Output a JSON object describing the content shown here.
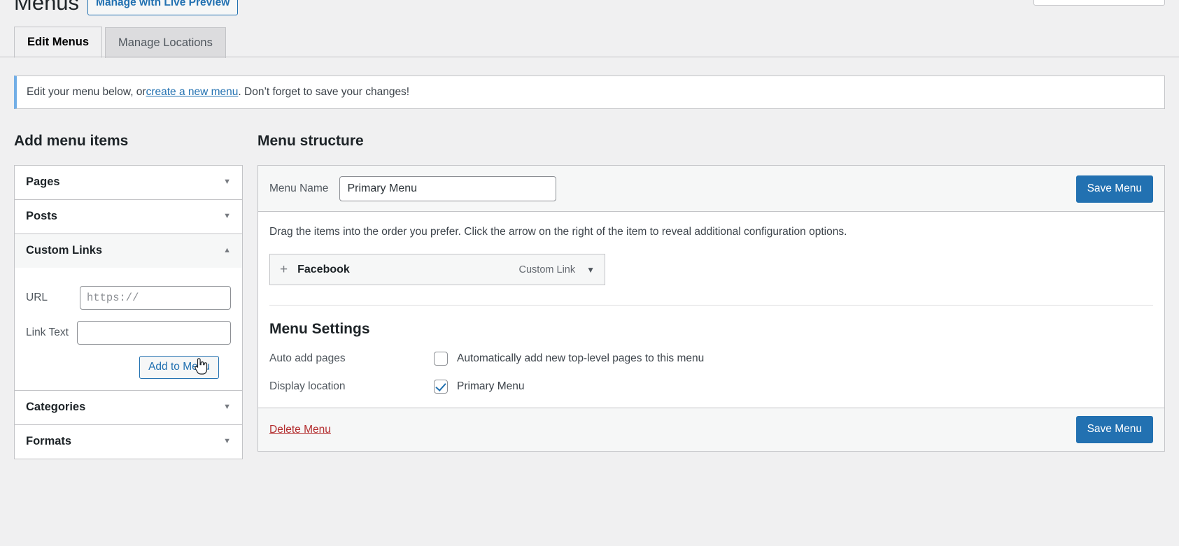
{
  "header": {
    "title": "Menus",
    "live_preview_label": "Manage with Live Preview"
  },
  "tabs": [
    {
      "label": "Edit Menus",
      "active": true
    },
    {
      "label": "Manage Locations",
      "active": false
    }
  ],
  "notice": {
    "prefix": "Edit your menu below, or ",
    "link": "create a new menu",
    "suffix": ". Don’t forget to save your changes!"
  },
  "add_menu_items": {
    "heading": "Add menu items",
    "sections": [
      {
        "title": "Pages",
        "open": false,
        "caret": "▼"
      },
      {
        "title": "Posts",
        "open": false,
        "caret": "▼"
      },
      {
        "title": "Custom Links",
        "open": true,
        "caret": "▲"
      },
      {
        "title": "Categories",
        "open": false,
        "caret": "▼"
      },
      {
        "title": "Formats",
        "open": false,
        "caret": "▼"
      }
    ],
    "custom_links": {
      "url_label": "URL",
      "url_value": "",
      "url_placeholder": "https://",
      "link_text_label": "Link Text",
      "link_text_value": "",
      "link_text_placeholder": "",
      "add_button_label": "Add to Menu"
    }
  },
  "menu_structure": {
    "heading": "Menu structure",
    "menu_name_label": "Menu Name",
    "menu_name_value": "Primary Menu",
    "save_top_label": "Save Menu",
    "drag_hint": "Drag the items into the order you prefer. Click the arrow on the right of the item to reveal additional configuration options.",
    "items": [
      {
        "move_icon": "+",
        "title": "Facebook",
        "type": "Custom Link",
        "caret": "▼"
      }
    ],
    "settings": {
      "title": "Menu Settings",
      "rows": [
        {
          "label": "Auto add pages",
          "checked": false,
          "text": "Automatically add new top-level pages to this menu"
        },
        {
          "label": "Display location",
          "checked": true,
          "text": "Primary Menu"
        }
      ]
    },
    "footer": {
      "delete_label": "Delete Menu",
      "save_label": "Save Menu"
    }
  },
  "colors": {
    "accent": "#2271b1",
    "danger": "#b32d2e",
    "notice_border": "#72aee6",
    "page_bg": "#f0f0f1"
  }
}
